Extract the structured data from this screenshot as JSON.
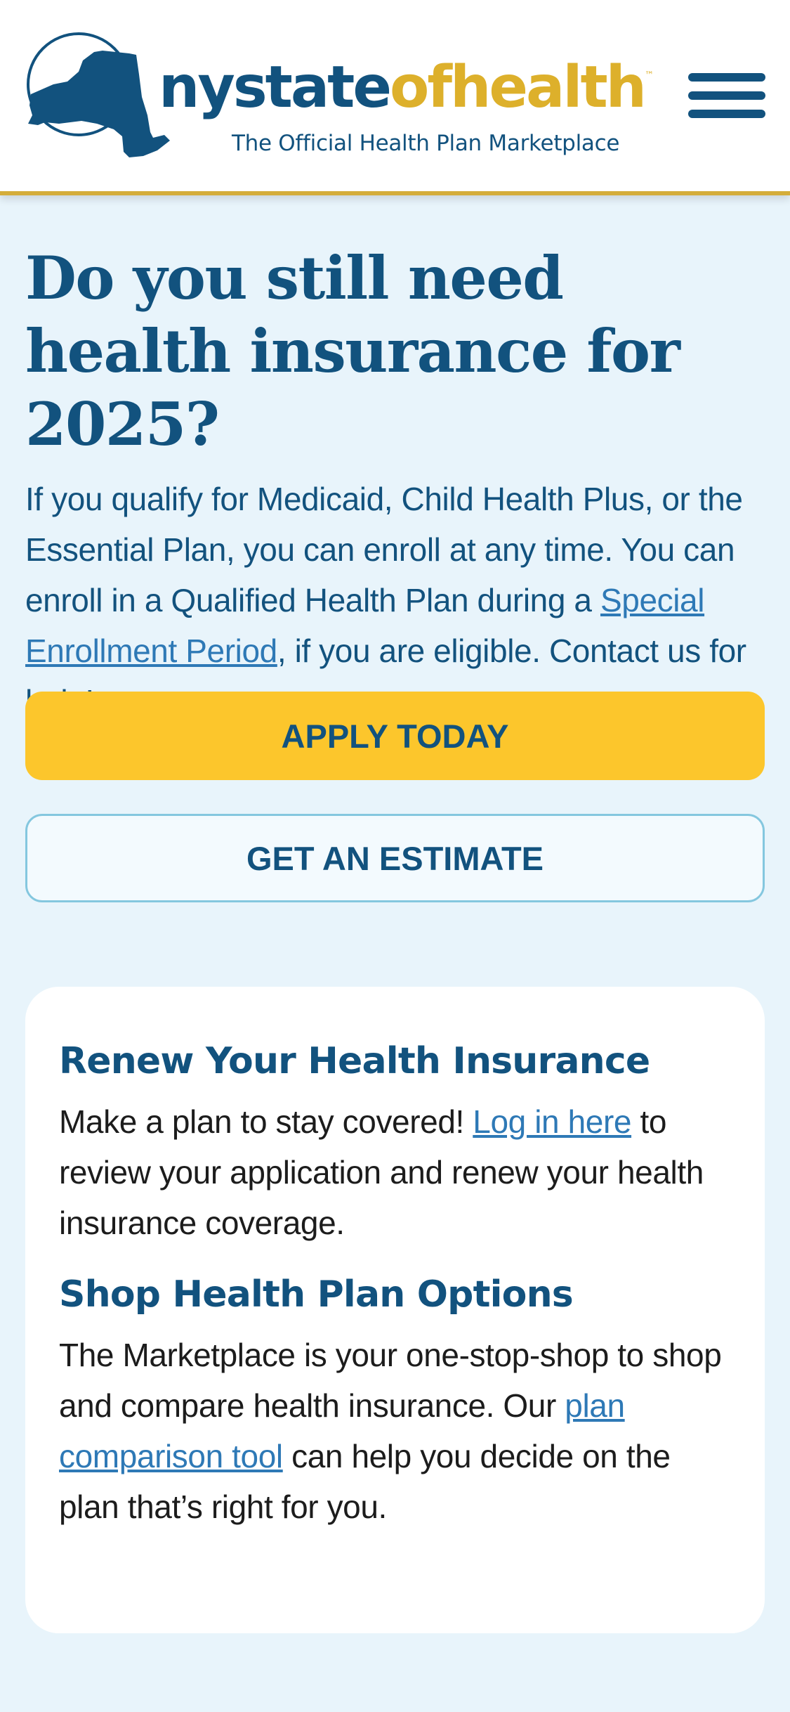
{
  "header": {
    "logo_ny": "ny",
    "logo_state": "state",
    "logo_of_health": "ofhealth",
    "trademark": "™",
    "tagline": "The Official Health Plan Marketplace",
    "menu_icon": "hamburger-menu-icon"
  },
  "hero": {
    "title": "Do you still need health insurance for 2025?",
    "text_before_link": "If you qualify for Medicaid, Child Health Plus, or the Essential Plan, you can enroll at any time. You can enroll in a Qualified Health Plan during a ",
    "link_text": "Special Enrollment Period",
    "text_after_link": ", if you are eligible. Contact us for help!"
  },
  "buttons": {
    "apply": "APPLY TODAY",
    "estimate": "GET AN ESTIMATE"
  },
  "card": {
    "renew": {
      "title": "Renew Your Health Insurance",
      "text_before_link": "Make a plan to stay covered! ",
      "link_text": "Log in here",
      "text_after_link": " to review your application and renew your health insurance coverage."
    },
    "shop": {
      "title": "Shop Health Plan Options",
      "text_before_link": "The Marketplace is your one-stop-shop to shop and compare health insurance. Our ",
      "link_text": "plan comparison tool",
      "text_after_link": " can help you decide on the plan that’s right for you."
    }
  },
  "colors": {
    "brand_blue": "#12527e",
    "brand_gold": "#ddb02b",
    "apply_yellow": "#fcc62c",
    "page_bg": "#e8f4fb",
    "link_blue": "#2e79b6"
  }
}
